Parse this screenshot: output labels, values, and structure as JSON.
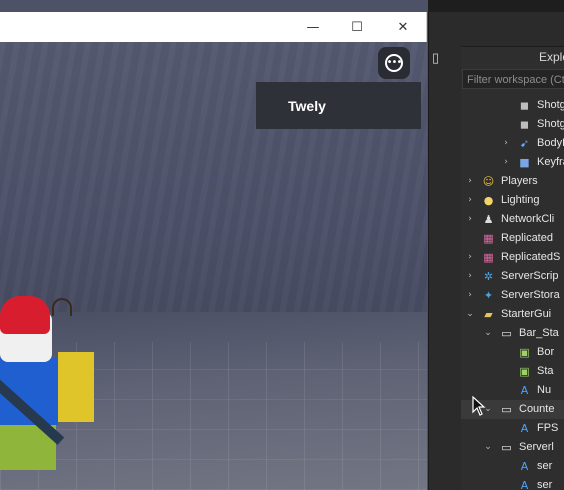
{
  "game": {
    "player_name": "Twely",
    "menu_icon": "ellipsis-icon"
  },
  "window_controls": {
    "minimize": "—",
    "maximize": "☐",
    "close": "✕"
  },
  "explorer": {
    "title": "Explo",
    "filter_placeholder": "Filter workspace (Ct",
    "items": [
      {
        "label": "Shotgu",
        "icon": "part-icon",
        "expand": ""
      },
      {
        "label": "Shotgu",
        "icon": "part-icon",
        "expand": ""
      },
      {
        "label": "BodyFo",
        "icon": "force-icon",
        "expand": "›"
      },
      {
        "label": "Keyfran",
        "icon": "keyframe-icon",
        "expand": "›"
      },
      {
        "label": "Players",
        "icon": "players-icon",
        "expand": "›"
      },
      {
        "label": "Lighting",
        "icon": "lighting-icon",
        "expand": "›"
      },
      {
        "label": "NetworkCli",
        "icon": "network-icon",
        "expand": "›"
      },
      {
        "label": "Replicated",
        "icon": "replicated-icon",
        "expand": ""
      },
      {
        "label": "ReplicatedS",
        "icon": "replicated-icon",
        "expand": "›"
      },
      {
        "label": "ServerScrip",
        "icon": "server-script-icon",
        "expand": "›"
      },
      {
        "label": "ServerStora",
        "icon": "server-storage-icon",
        "expand": "›"
      },
      {
        "label": "StarterGui",
        "icon": "folder-icon",
        "expand": "⌄"
      },
      {
        "label": "Bar_Sta",
        "icon": "gui-icon",
        "expand": "⌄"
      },
      {
        "label": "Bor",
        "icon": "image-icon",
        "expand": ""
      },
      {
        "label": "Sta",
        "icon": "image-icon",
        "expand": ""
      },
      {
        "label": "Nu",
        "icon": "text-icon",
        "expand": ""
      },
      {
        "label": "Counte",
        "icon": "gui-icon",
        "expand": "⌄"
      },
      {
        "label": "FPS",
        "icon": "text-icon",
        "expand": ""
      },
      {
        "label": "Serverl",
        "icon": "gui-icon",
        "expand": "⌄"
      },
      {
        "label": "ser",
        "icon": "text-icon",
        "expand": ""
      },
      {
        "label": "ser",
        "icon": "text-icon",
        "expand": ""
      }
    ]
  }
}
